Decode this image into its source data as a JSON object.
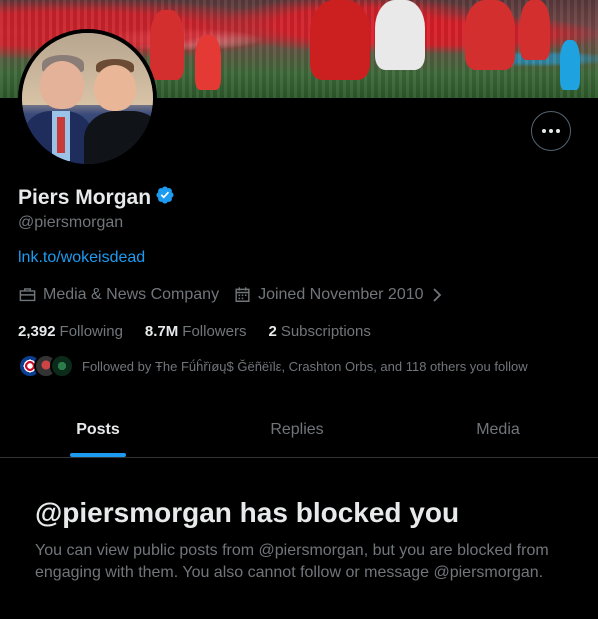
{
  "banner": {
    "alt": "Arsenal players celebrating"
  },
  "avatar": {
    "alt": "Profile photo"
  },
  "profile": {
    "name": "Piers Morgan",
    "handle": "@piersmorgan",
    "link": "lnk.to/wokeisdead",
    "category": "Media & News Company",
    "joined": "Joined November 2010",
    "following_count": "2,392",
    "following_label": "Following",
    "followers_count": "8.7M",
    "followers_label": "Followers",
    "subscriptions_count": "2",
    "subscriptions_label": "Subscriptions",
    "followed_by": "Followed by Ŧhe Fǘĥřïøų$ Ğëñëïlε, Crashton Orbs, and 118 others you follow"
  },
  "icons": {
    "verified": "verified-badge-icon",
    "category": "briefcase-icon",
    "joined": "calendar-icon",
    "more": "more-dots-icon",
    "chevron": "chevron-right-icon"
  },
  "colors": {
    "accent": "#1d9bf0",
    "background": "#000000",
    "muted": "#71767b",
    "text": "#e7e9ea"
  },
  "tabs": [
    {
      "label": "Posts",
      "active": true
    },
    {
      "label": "Replies",
      "active": false
    },
    {
      "label": "Media",
      "active": false
    }
  ],
  "blocked": {
    "title": "@piersmorgan has blocked you",
    "message": "You can view public posts from @piersmorgan, but you are blocked from engaging with them. You also cannot follow or message @piersmorgan."
  }
}
